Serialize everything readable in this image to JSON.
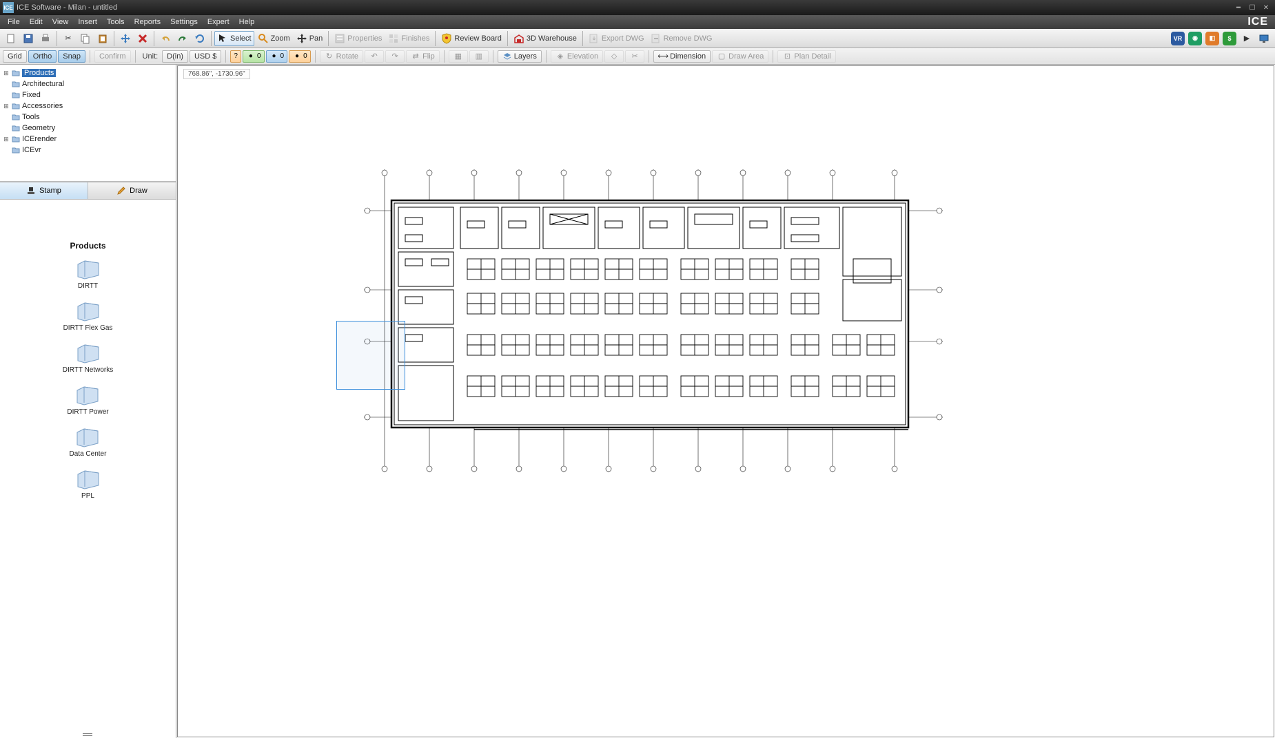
{
  "window": {
    "title": "ICE Software - Milan - untitled",
    "brand": "ICE"
  },
  "menu": [
    "File",
    "Edit",
    "View",
    "Insert",
    "Tools",
    "Reports",
    "Settings",
    "Expert",
    "Help"
  ],
  "toolbar1": {
    "select": "Select",
    "zoom": "Zoom",
    "pan": "Pan",
    "properties": "Properties",
    "finishes": "Finishes",
    "review_board": "Review Board",
    "warehouse_3d": "3D Warehouse",
    "export_dwg": "Export DWG",
    "remove_dwg": "Remove DWG"
  },
  "toolbar2": {
    "grid": "Grid",
    "ortho": "Ortho",
    "snap": "Snap",
    "confirm": "Confirm",
    "unit_label": "Unit:",
    "unit_value": "D(in)",
    "currency": "USD $",
    "zero_a": "0",
    "zero_b": "0",
    "zero_c": "0",
    "rotate": "Rotate",
    "flip": "Flip",
    "layers": "Layers",
    "elevation": "Elevation",
    "dimension": "Dimension",
    "draw_area": "Draw Area",
    "plan_detail": "Plan Detail",
    "question": "?"
  },
  "tree": [
    {
      "label": "Products",
      "expandable": true,
      "selected": true
    },
    {
      "label": "Architectural",
      "expandable": false
    },
    {
      "label": "Fixed",
      "expandable": false
    },
    {
      "label": "Accessories",
      "expandable": true
    },
    {
      "label": "Tools",
      "expandable": false
    },
    {
      "label": "Geometry",
      "expandable": false
    },
    {
      "label": "ICErender",
      "expandable": true
    },
    {
      "label": "ICEvr",
      "expandable": false
    }
  ],
  "tabs": {
    "stamp": "Stamp",
    "draw": "Draw"
  },
  "panel": {
    "heading": "Products",
    "items": [
      "DIRTT",
      "DIRTT Flex Gas",
      "DIRTT Networks",
      "DIRTT Power",
      "Data Center",
      "PPL"
    ]
  },
  "canvas": {
    "coords": "768.86\", -1730.96\""
  }
}
